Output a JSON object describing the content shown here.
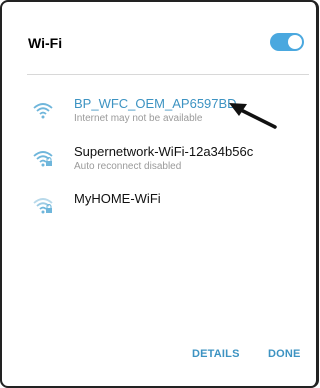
{
  "dialog": {
    "title": "Wi-Fi",
    "wifi_toggle": "on"
  },
  "networks": [
    {
      "name": "BP_WFC_OEM_AP6597BD",
      "status": "Internet may not be available",
      "icon": "wifi-signal-icon",
      "state": "connected"
    },
    {
      "name": "Supernetwork-WiFi-12a34b56c",
      "status": "Auto reconnect disabled",
      "icon": "wifi-lock-icon"
    },
    {
      "name": "MyHOME-WiFi",
      "status": "",
      "icon": "wifi-lock-icon"
    }
  ],
  "buttons": {
    "details": "DETAILS",
    "done": "DONE"
  },
  "colors": {
    "accent": "#3d93c2",
    "toggle": "#4aa8df",
    "secondary_text": "#9a9a9a"
  }
}
